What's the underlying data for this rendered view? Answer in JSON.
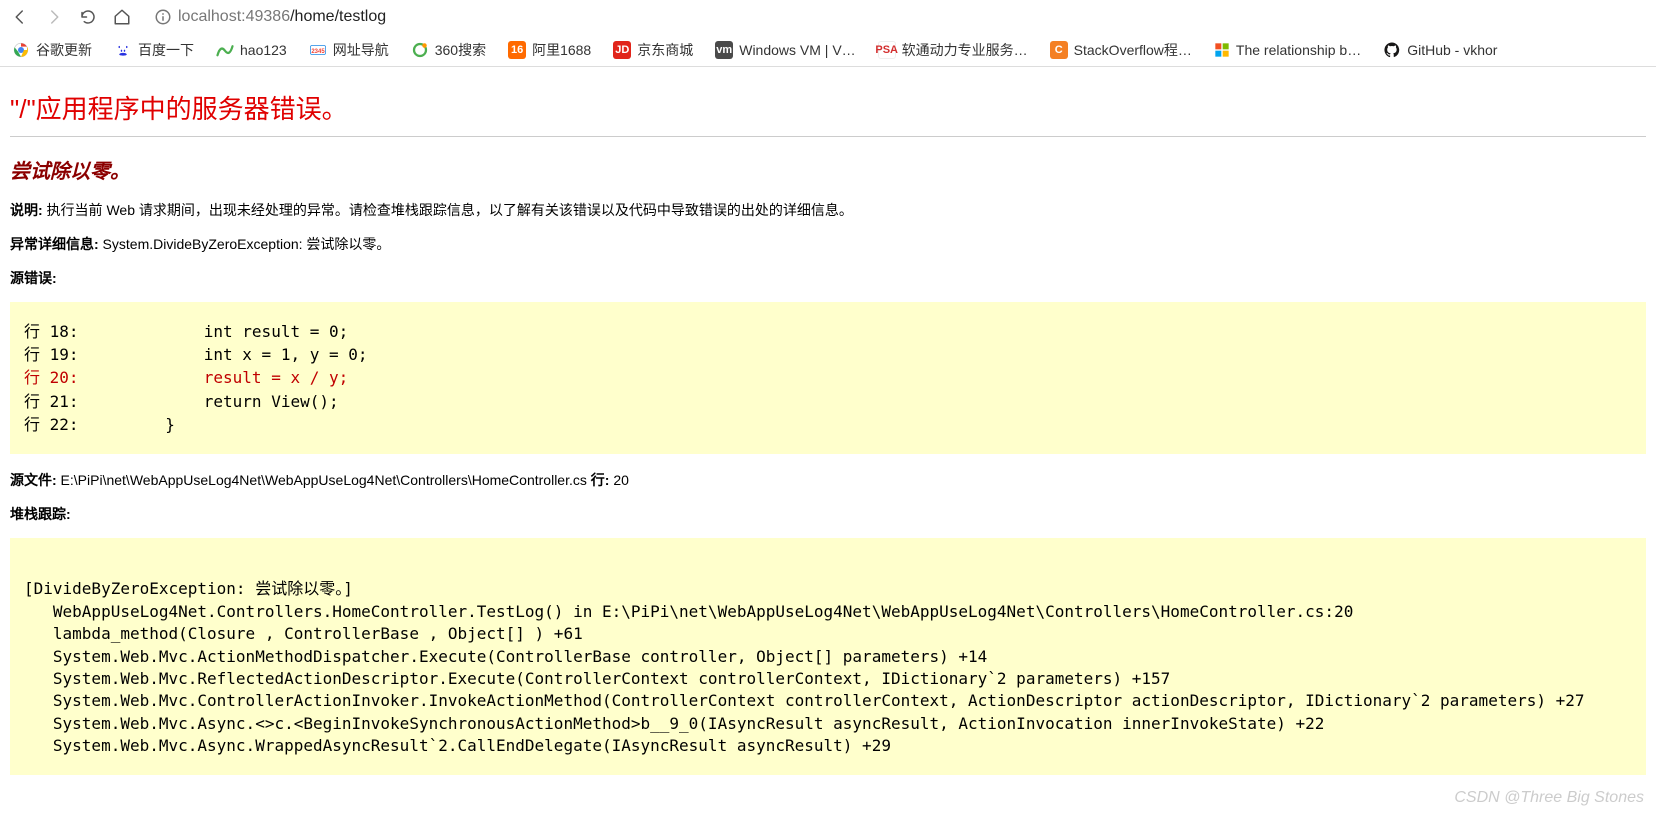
{
  "address": {
    "prefix": "localhost:",
    "port": "49386",
    "path": "/home/testlog"
  },
  "bookmarks": [
    {
      "label": "谷歌更新",
      "bg": "#fff"
    },
    {
      "label": "百度一下",
      "bg": "#fff"
    },
    {
      "label": "hao123",
      "bg": "#fff"
    },
    {
      "label": "网址导航",
      "bg": "#fff"
    },
    {
      "label": "360搜索",
      "bg": "#fff"
    },
    {
      "label": "阿里1688",
      "bg": "#ff6a00"
    },
    {
      "label": "京东商城",
      "bg": "#e1251b"
    },
    {
      "label": "Windows VM | V…",
      "bg": "#4a4a4a"
    },
    {
      "label": "软通动力专业服务…",
      "bg": "#fff"
    },
    {
      "label": "StackOverflow程…",
      "bg": "#f48024"
    },
    {
      "label": "The relationship b…",
      "bg": "#fff"
    },
    {
      "label": "GitHub - vkhor",
      "bg": "#000"
    }
  ],
  "error": {
    "heading": "\"/\"应用程序中的服务器错误。",
    "subheading": "尝试除以零。",
    "desc_label": "说明:",
    "desc_text": " 执行当前 Web 请求期间，出现未经处理的异常。请检查堆栈跟踪信息，以了解有关该错误以及代码中导致错误的出处的详细信息。",
    "detail_label": "异常详细信息:",
    "detail_text": " System.DivideByZeroException: 尝试除以零。",
    "src_error_label": "源错误:",
    "code": {
      "l18": "行 18:             int result = 0;",
      "l19": "行 19:             int x = 1, y = 0;",
      "l20": "行 20:             result = x / y;",
      "l21": "行 21:             return View();",
      "l22": "行 22:         }"
    },
    "srcfile_label": "源文件:",
    "srcfile_text": " E:\\PiPi\\net\\WebAppUseLog4Net\\WebAppUseLog4Net\\Controllers\\HomeController.cs    ",
    "line_label": "行:",
    "line_text": " 20",
    "stack_label": "堆栈跟踪:",
    "stack_text": "\n[DivideByZeroException: 尝试除以零。]\n   WebAppUseLog4Net.Controllers.HomeController.TestLog() in E:\\PiPi\\net\\WebAppUseLog4Net\\WebAppUseLog4Net\\Controllers\\HomeController.cs:20\n   lambda_method(Closure , ControllerBase , Object[] ) +61\n   System.Web.Mvc.ActionMethodDispatcher.Execute(ControllerBase controller, Object[] parameters) +14\n   System.Web.Mvc.ReflectedActionDescriptor.Execute(ControllerContext controllerContext, IDictionary`2 parameters) +157\n   System.Web.Mvc.ControllerActionInvoker.InvokeActionMethod(ControllerContext controllerContext, ActionDescriptor actionDescriptor, IDictionary`2 parameters) +27\n   System.Web.Mvc.Async.<>c.<BeginInvokeSynchronousActionMethod>b__9_0(IAsyncResult asyncResult, ActionInvocation innerInvokeState) +22\n   System.Web.Mvc.Async.WrappedAsyncResult`2.CallEndDelegate(IAsyncResult asyncResult) +29"
  },
  "watermark": "CSDN @Three Big Stones"
}
